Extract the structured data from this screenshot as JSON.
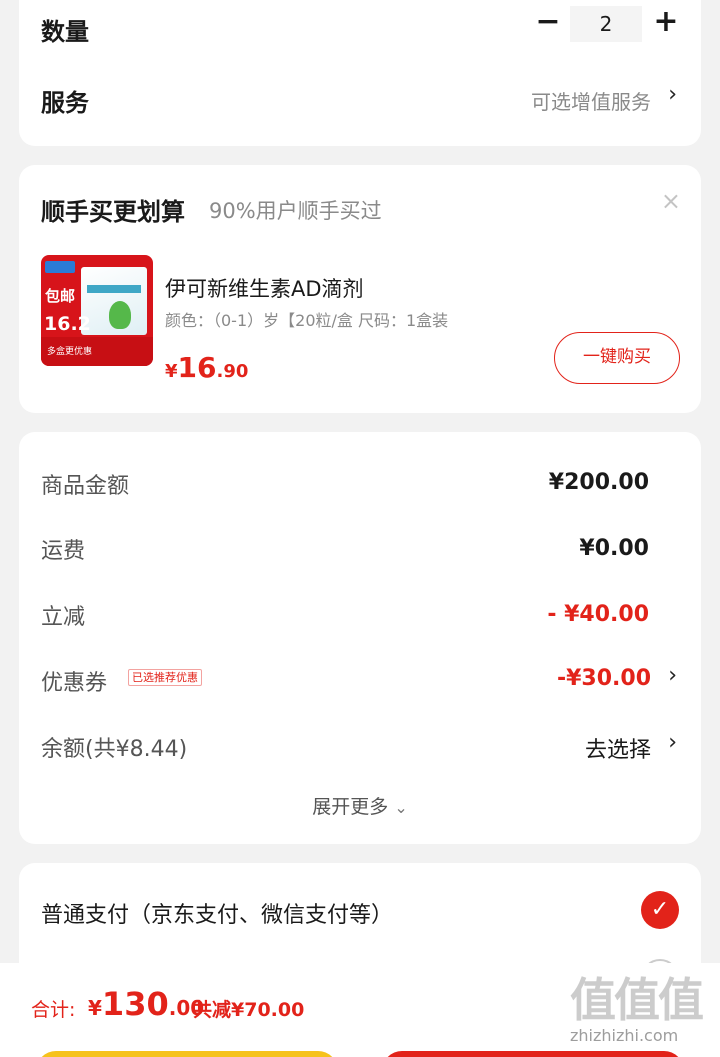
{
  "quantity": {
    "label": "数量",
    "minus": "−",
    "value": "2",
    "plus": "+"
  },
  "service": {
    "label": "服务",
    "value": "可选增值服务",
    "chevron": "›"
  },
  "bundle": {
    "title": "顺手买更划算",
    "subtitle": "90%用户顺手买过",
    "close": "×",
    "product": {
      "image_tag_top": "包邮",
      "image_tag_price": "16.2",
      "image_tag_bottom": "多盒更优惠",
      "name": "伊可新维生素AD滴剂",
      "spec": "颜色：（0-1）岁【20粒/盒   尺码：1盒装",
      "price_currency": "¥",
      "price_int": "16",
      "price_dec": ".90",
      "buy_label": "一键购买"
    }
  },
  "amounts": {
    "goods_label": "商品金额",
    "goods_value": "¥200.00",
    "shipping_label": "运费",
    "shipping_value": "¥0.00",
    "discount_label": "立减",
    "discount_value": "- ¥40.00",
    "coupon_label": "优惠券",
    "coupon_tag": "已选推荐优惠",
    "coupon_value": "-¥30.00",
    "balance_label": "余额(共¥8.44)",
    "balance_action": "去选择",
    "expand_label": "展开更多",
    "expand_icon": "⌄",
    "chevron": "›"
  },
  "payment": {
    "normal_label": "普通支付（京东支付、微信支付等）",
    "check_icon": "✓"
  },
  "footer": {
    "total_label": "合计:",
    "total_currency": "¥",
    "total_int": "130",
    "total_dec": ".00",
    "saved_label": "共减¥70.00"
  },
  "watermark": {
    "logo": "值值值",
    "url": "zhizhizhi.com"
  },
  "colors": {
    "accent_red": "#e2231a",
    "yellow_button": "#f6c21c",
    "page_bg": "#f2f2f2"
  }
}
